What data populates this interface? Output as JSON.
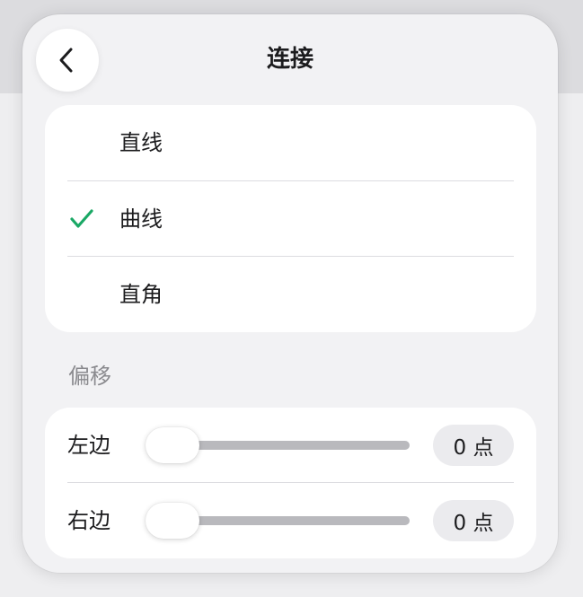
{
  "panel": {
    "title": "连接",
    "back_icon": "chevron-left-icon"
  },
  "connection": {
    "options": [
      {
        "label": "直线",
        "selected": false
      },
      {
        "label": "曲线",
        "selected": true
      },
      {
        "label": "直角",
        "selected": false
      }
    ],
    "check_icon": "checkmark-icon",
    "check_color": "#1aa865"
  },
  "offset": {
    "section_label": "偏移",
    "sliders": [
      {
        "label": "左边",
        "value": "0 点",
        "level": 0
      },
      {
        "label": "右边",
        "value": "0 点",
        "level": 0
      }
    ]
  }
}
